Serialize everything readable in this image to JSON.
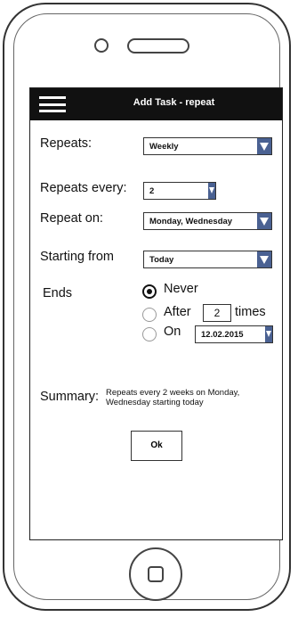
{
  "header": {
    "title": "Add Task - repeat"
  },
  "form": {
    "repeats": {
      "label": "Repeats:",
      "value": "Weekly"
    },
    "repeats_every": {
      "label": "Repeats every:",
      "value": "2"
    },
    "repeat_on": {
      "label": "Repeat on:",
      "value": "Monday, Wednesday"
    },
    "starting_from": {
      "label": "Starting from",
      "value": "Today"
    },
    "ends": {
      "label": "Ends",
      "never_label": "Never",
      "after_label": "After",
      "after_count": "2",
      "times_label": "times",
      "on_label": "On",
      "on_date": "12.02.2015",
      "selected": "Never"
    }
  },
  "summary": {
    "label": "Summary:",
    "text": "Repeats every 2 weeks on Monday, Wednesday starting today"
  },
  "actions": {
    "ok_label": "Ok"
  },
  "colors": {
    "accent": "#4a6192",
    "topbar": "#111111"
  }
}
